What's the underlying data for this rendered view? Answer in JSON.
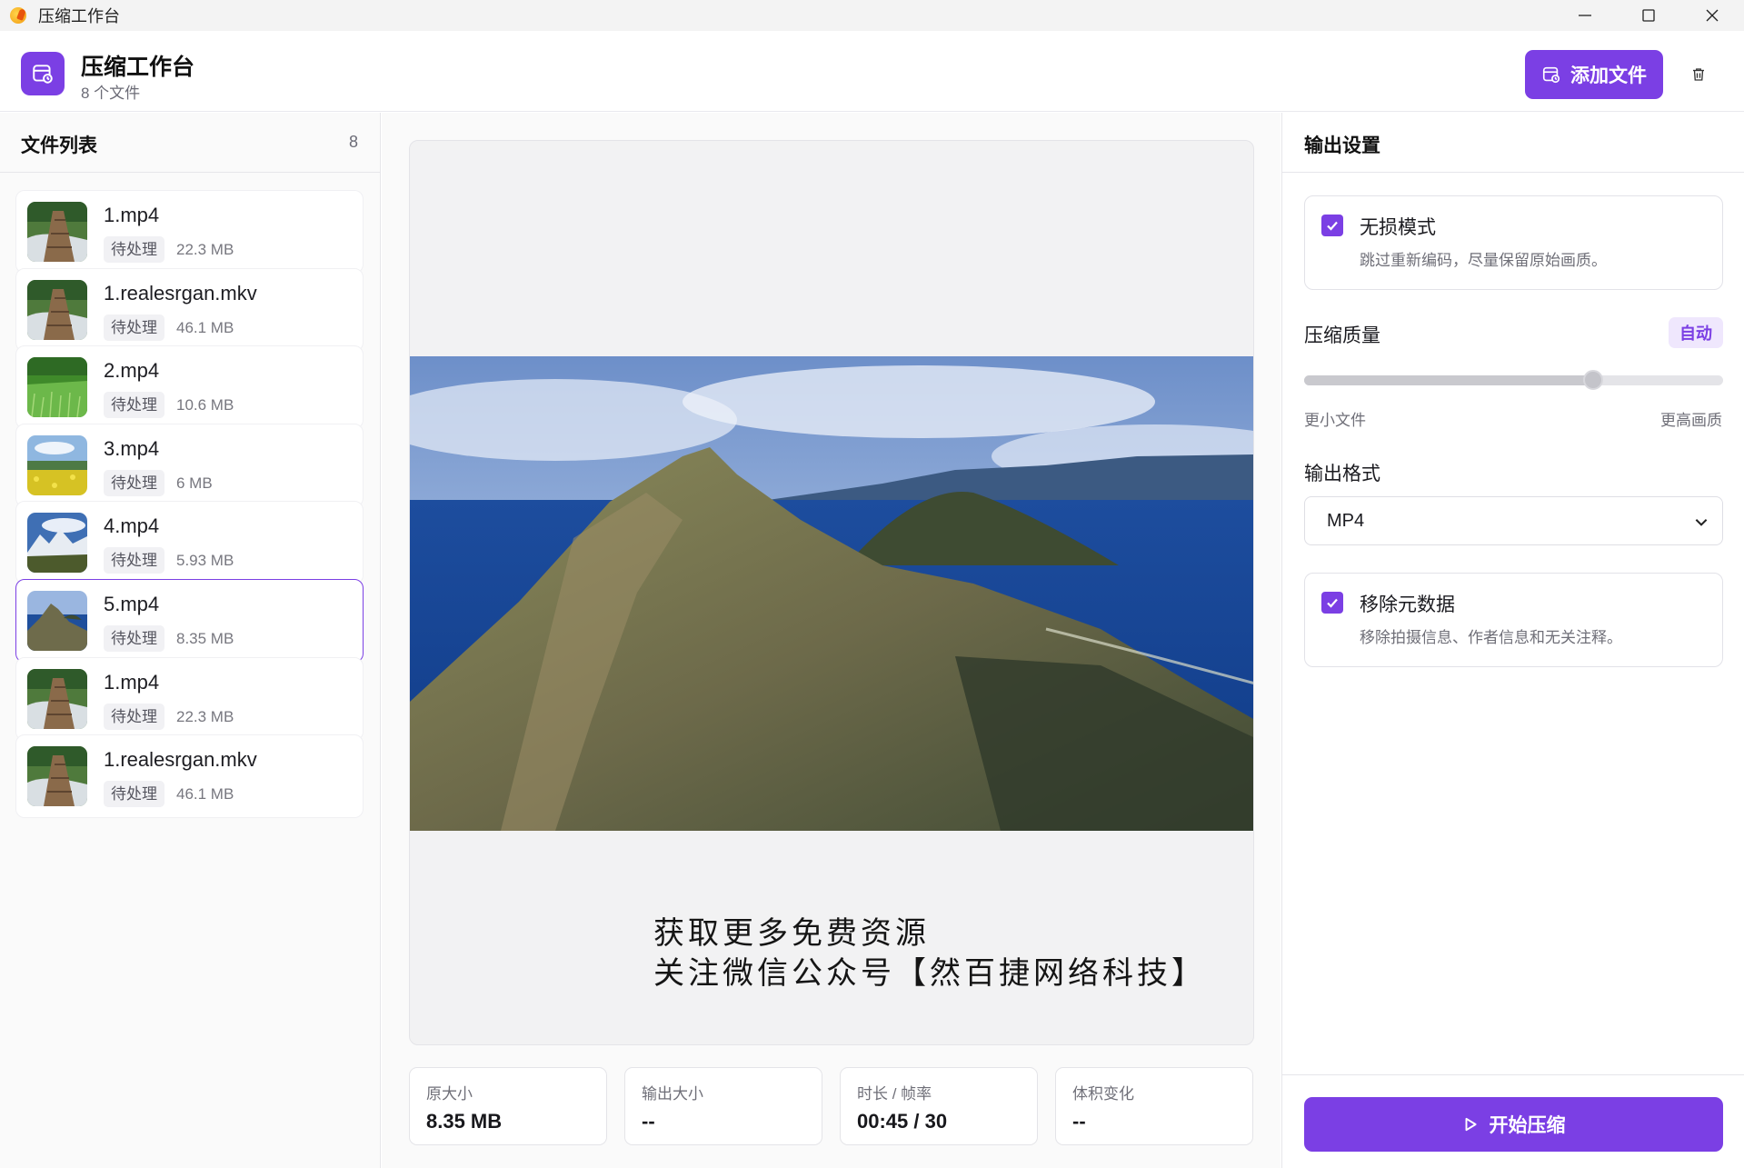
{
  "window": {
    "title": "压缩工作台"
  },
  "header": {
    "title": "压缩工作台",
    "subtitle": "8 个文件",
    "add_button": "添加文件"
  },
  "file_list": {
    "title": "文件列表",
    "count": "8",
    "items": [
      {
        "name": "1.mp4",
        "status": "待处理",
        "size": "22.3 MB",
        "thumb": "boardwalk"
      },
      {
        "name": "1.realesrgan.mkv",
        "status": "待处理",
        "size": "46.1 MB",
        "thumb": "boardwalk"
      },
      {
        "name": "2.mp4",
        "status": "待处理",
        "size": "10.6 MB",
        "thumb": "grass"
      },
      {
        "name": "3.mp4",
        "status": "待处理",
        "size": "6 MB",
        "thumb": "flowers"
      },
      {
        "name": "4.mp4",
        "status": "待处理",
        "size": "5.93 MB",
        "thumb": "mountains"
      },
      {
        "name": "5.mp4",
        "status": "待处理",
        "size": "8.35 MB",
        "thumb": "island",
        "selected": true
      },
      {
        "name": "1.mp4",
        "status": "待处理",
        "size": "22.3 MB",
        "thumb": "boardwalk"
      },
      {
        "name": "1.realesrgan.mkv",
        "status": "待处理",
        "size": "46.1 MB",
        "thumb": "boardwalk"
      }
    ]
  },
  "preview": {
    "overlay_line1": "获取更多免费资源",
    "overlay_line2": "关注微信公众号【然百捷网络科技】"
  },
  "stats": [
    {
      "label": "原大小",
      "value": "8.35 MB"
    },
    {
      "label": "输出大小",
      "value": "--"
    },
    {
      "label": "时长 / 帧率",
      "value": "00:45 / 30"
    },
    {
      "label": "体积变化",
      "value": "--"
    }
  ],
  "settings": {
    "title": "输出设置",
    "lossless": {
      "title": "无损模式",
      "desc": "跳过重新编码，尽量保留原始画质。",
      "checked": true
    },
    "quality": {
      "label": "压缩质量",
      "badge": "自动",
      "value_percent": 69,
      "min_label": "更小文件",
      "max_label": "更高画质"
    },
    "format": {
      "label": "输出格式",
      "value": "MP4"
    },
    "strip_metadata": {
      "title": "移除元数据",
      "desc": "移除拍摄信息、作者信息和无关注释。",
      "checked": true
    },
    "start_button": "开始压缩"
  },
  "colors": {
    "accent": "#7b3fe4",
    "accent_light": "#efe7fd"
  }
}
